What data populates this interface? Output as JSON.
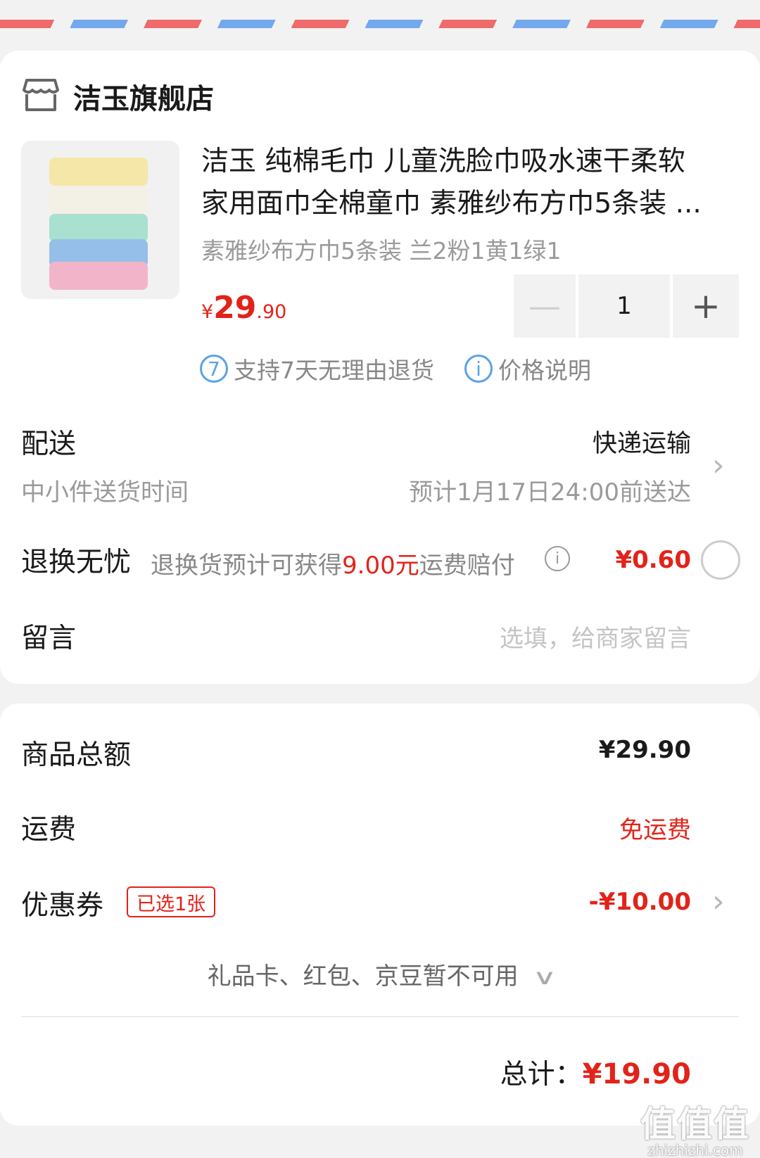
{
  "store": {
    "name": "洁玉旗舰店"
  },
  "product": {
    "title_line1": "洁玉 纯棉毛巾 儿童洗脸巾吸水速干柔软",
    "title_line2": "家用面巾全棉童巾 素雅纱布方巾5条装 ...",
    "variant": "素雅纱布方巾5条装 兰2粉1黄1绿1",
    "price_symbol": "¥",
    "price_int": "29",
    "price_dec": ".90",
    "quantity": "1",
    "minus_glyph": "—",
    "plus_glyph": "+",
    "thumb_colors": [
      "#f4e7a8",
      "#f3f0e6",
      "#a9e0cf",
      "#95bfe9",
      "#f2b4c9"
    ]
  },
  "badges": {
    "return_num": "7",
    "return_text": "支持7天无理由退货",
    "price_info_glyph": "i",
    "price_info_text": "价格说明"
  },
  "delivery": {
    "label": "配送",
    "method": "快递运输",
    "sub_label": "中小件送货时间",
    "estimate": "预计1月17日24:00前送达"
  },
  "exchange": {
    "label": "退换无忧",
    "desc_prefix": "退换货预计可获得",
    "desc_amount": "9.00元",
    "desc_suffix": "运费赔付",
    "price": "¥0.60",
    "selected": false
  },
  "message": {
    "label": "留言",
    "placeholder": "选填，给商家留言"
  },
  "summary": {
    "goods_label": "商品总额",
    "goods_value": "¥29.90",
    "shipping_label": "运费",
    "shipping_value": "免运费",
    "coupon_label": "优惠券",
    "coupon_tag": "已选1张",
    "coupon_value": "-¥10.00",
    "unavailable": "礼品卡、红包、京豆暂不可用",
    "total_label": "总计：",
    "total_value": "¥19.90"
  },
  "watermark": {
    "big": "值值值",
    "small": "zhizhizhi.com"
  },
  "colors": {
    "accent_red": "#e2231a",
    "info_blue": "#5aa2e8",
    "stripe_red": "#ef6a6a",
    "stripe_blue": "#74a8ec"
  }
}
